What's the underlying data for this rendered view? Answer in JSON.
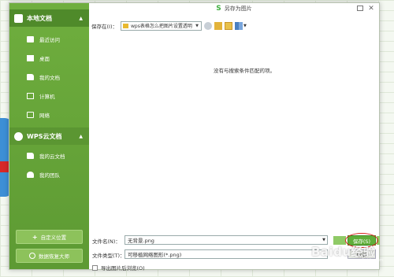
{
  "dialog": {
    "title": "另存为图片",
    "logo": "S"
  },
  "sidebar": {
    "local_section": "本地文档",
    "items_local": [
      {
        "label": "最近访问",
        "icon": "recent-icon"
      },
      {
        "label": "桌面",
        "icon": "desktop-icon"
      },
      {
        "label": "我的文档",
        "icon": "folder-icon"
      },
      {
        "label": "计算机",
        "icon": "computer-icon"
      },
      {
        "label": "网络",
        "icon": "network-icon"
      }
    ],
    "cloud_section": "WPS云文档",
    "items_cloud": [
      {
        "label": "我的云文档",
        "icon": "cloud-folder-icon"
      },
      {
        "label": "我的团队",
        "icon": "team-icon"
      }
    ],
    "custom_location_label": "自定义位置",
    "data_recovery_label": "数据恢复大师"
  },
  "location": {
    "label": "保存在(I)：",
    "value": "wps表格怎么把图片设置透明"
  },
  "file_list": {
    "empty_message": "没有与搜索条件匹配的项。"
  },
  "form": {
    "filename_label": "文件名(N)：",
    "filename_value": "无背景.png",
    "filetype_label": "文件类型(T)：",
    "filetype_value": "可移植网络图形(*.png)",
    "save_label": "保存(S)",
    "cancel_label": "取消",
    "open_after_label": "导出图片后浏览(O)"
  },
  "watermark": {
    "text": "Baidu经验",
    "sub": "jingyan.baidu.com"
  },
  "colors": {
    "sidebar_green": "#6fae3e",
    "save_green": "#5fae3a",
    "highlight_red": "#d9231f"
  }
}
